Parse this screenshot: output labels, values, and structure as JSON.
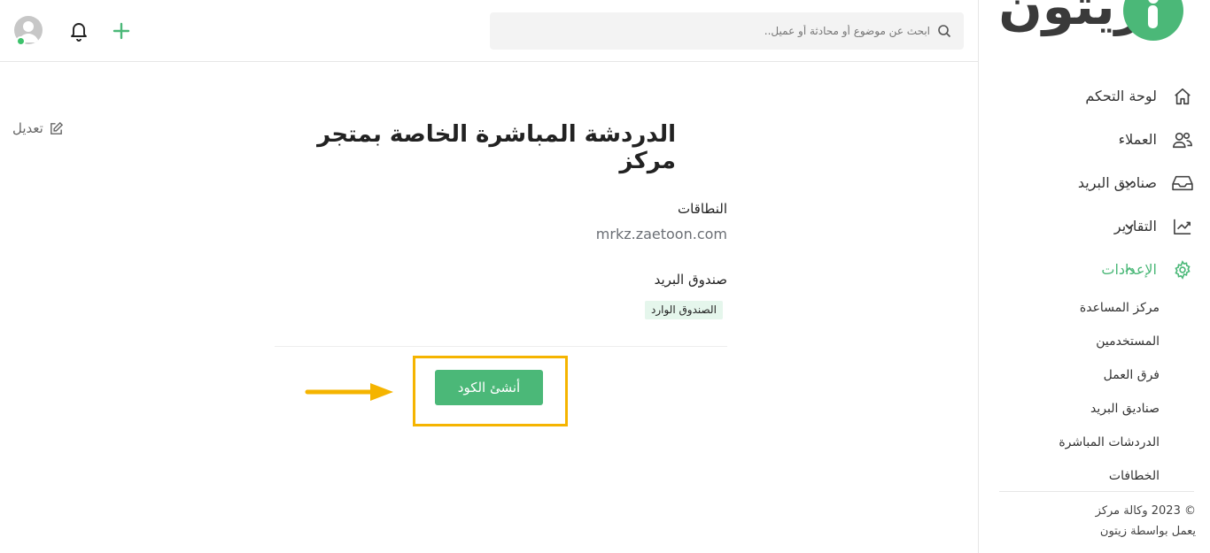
{
  "brand": {
    "logo_text": "زيتون",
    "accent_color": "#4bb878",
    "highlight_color": "#f5b400"
  },
  "sidebar": {
    "items": [
      {
        "label": "لوحة التحكم",
        "icon": "home-icon"
      },
      {
        "label": "العملاء",
        "icon": "users-icon"
      },
      {
        "label": "صناديق البريد",
        "icon": "inbox-icon",
        "expandable": true
      },
      {
        "label": "التقارير",
        "icon": "chart-line-icon",
        "expandable": true
      },
      {
        "label": "الإعدادات",
        "icon": "gear-icon",
        "expanded": true,
        "active": true
      }
    ],
    "settings_subitems": [
      "مركز المساعدة",
      "المستخدمين",
      "فرق العمل",
      "صناديق البريد",
      "الدردشات المباشرة",
      "الخطافات"
    ],
    "footer": {
      "copyright": "© 2023 وكالة مركز",
      "powered_by": "يعمل بواسطة زيتون"
    }
  },
  "topbar": {
    "search_placeholder": "ابحث عن موضوع أو محادثة أو عميل..",
    "icons": [
      "plus-icon",
      "bell-icon",
      "avatar"
    ]
  },
  "main": {
    "title": "الدردشة المباشرة الخاصة بمتجر مركز",
    "edit_label": "تعديل",
    "domains_label": "النطاقات",
    "domains_value": "mrkz.zaetoon.com",
    "inbox_label": "صندوق البريد",
    "inbox_tag": "الصندوق الوارد",
    "generate_button": "أنشئ الكود"
  }
}
